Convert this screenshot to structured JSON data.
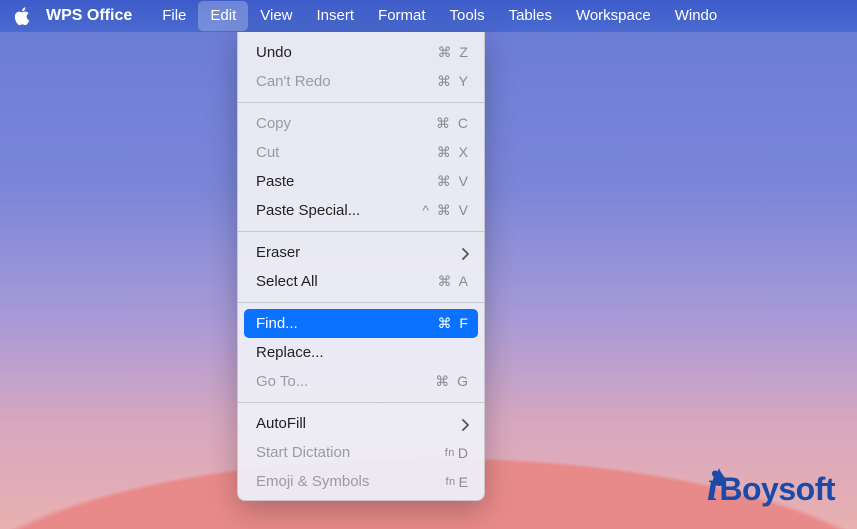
{
  "menubar": {
    "app_name": "WPS Office",
    "items": [
      "File",
      "Edit",
      "View",
      "Insert",
      "Format",
      "Tools",
      "Tables",
      "Workspace",
      "Windo"
    ],
    "active_index": 1
  },
  "dropdown": {
    "groups": [
      [
        {
          "label": "Undo",
          "shortcut": "⌘ Z",
          "disabled": false
        },
        {
          "label": "Can't Redo",
          "shortcut": "⌘ Y",
          "disabled": true
        }
      ],
      [
        {
          "label": "Copy",
          "shortcut": "⌘ C",
          "disabled": true
        },
        {
          "label": "Cut",
          "shortcut": "⌘ X",
          "disabled": true
        },
        {
          "label": "Paste",
          "shortcut": "⌘ V",
          "disabled": false
        },
        {
          "label": "Paste Special...",
          "shortcut": "^ ⌘ V",
          "disabled": false
        }
      ],
      [
        {
          "label": "Eraser",
          "submenu": true,
          "disabled": false
        },
        {
          "label": "Select All",
          "shortcut": "⌘ A",
          "disabled": false
        }
      ],
      [
        {
          "label": "Find...",
          "shortcut": "⌘ F",
          "disabled": false,
          "highlight": true
        },
        {
          "label": "Replace...",
          "disabled": false
        },
        {
          "label": "Go To...",
          "shortcut": "⌘ G",
          "disabled": true
        }
      ],
      [
        {
          "label": "AutoFill",
          "submenu": true,
          "disabled": false
        },
        {
          "label": "Start Dictation",
          "shortcut_fn": "fn",
          "shortcut": "D",
          "disabled": true
        },
        {
          "label": "Emoji & Symbols",
          "shortcut_fn": "fn",
          "shortcut": "E",
          "disabled": true
        }
      ]
    ]
  },
  "watermark": {
    "prefix": "i",
    "rest": "Boysoft"
  }
}
